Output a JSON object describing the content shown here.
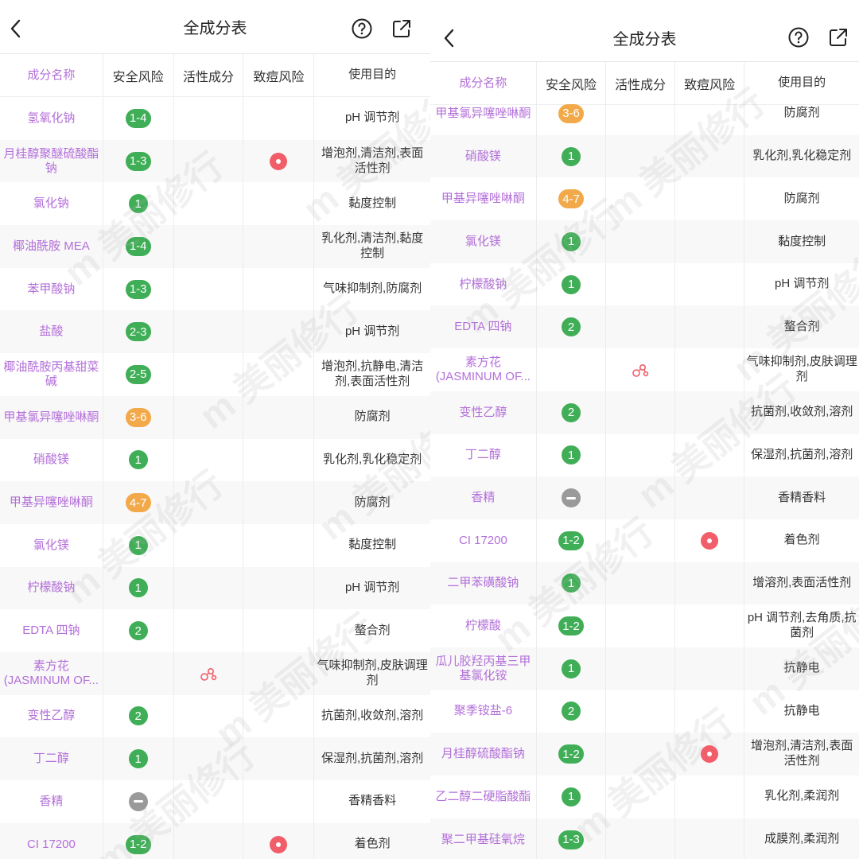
{
  "header": {
    "title": "全成分表"
  },
  "columns": [
    "成分名称",
    "安全风险",
    "活性成分",
    "致痘风险",
    "使用目的"
  ],
  "watermark": "m 美丽修行",
  "colors": {
    "ingredient": "#b36fd9",
    "badge_green": "#3fae56",
    "badge_orange": "#f2a94a",
    "acne": "#f15e6a"
  },
  "left_rows": [
    {
      "name": "氢氧化钠",
      "risk": "1-4",
      "risk_color": "green",
      "active": false,
      "acne": false,
      "purpose": "pH 调节剂"
    },
    {
      "name": "月桂醇聚醚硫酸酯钠",
      "risk": "1-3",
      "risk_color": "green",
      "active": false,
      "acne": true,
      "purpose": "增泡剂,清洁剂,表面活性剂"
    },
    {
      "name": "氯化钠",
      "risk": "1",
      "risk_color": "green",
      "active": false,
      "acne": false,
      "purpose": "黏度控制"
    },
    {
      "name": "椰油酰胺 MEA",
      "risk": "1-4",
      "risk_color": "green",
      "active": false,
      "acne": false,
      "purpose": "乳化剂,清洁剂,黏度控制"
    },
    {
      "name": "苯甲酸钠",
      "risk": "1-3",
      "risk_color": "green",
      "active": false,
      "acne": false,
      "purpose": "气味抑制剂,防腐剂"
    },
    {
      "name": "盐酸",
      "risk": "2-3",
      "risk_color": "green",
      "active": false,
      "acne": false,
      "purpose": "pH 调节剂"
    },
    {
      "name": "椰油酰胺丙基甜菜碱",
      "risk": "2-5",
      "risk_color": "green",
      "active": false,
      "acne": false,
      "purpose": "增泡剂,抗静电,清洁剂,表面活性剂"
    },
    {
      "name": "甲基氯异噻唑啉酮",
      "risk": "3-6",
      "risk_color": "orange",
      "active": false,
      "acne": false,
      "purpose": "防腐剂"
    },
    {
      "name": "硝酸镁",
      "risk": "1",
      "risk_color": "green",
      "active": false,
      "acne": false,
      "purpose": "乳化剂,乳化稳定剂"
    },
    {
      "name": "甲基异噻唑啉酮",
      "risk": "4-7",
      "risk_color": "orange",
      "active": false,
      "acne": false,
      "purpose": "防腐剂"
    },
    {
      "name": "氯化镁",
      "risk": "1",
      "risk_color": "green",
      "active": false,
      "acne": false,
      "purpose": "黏度控制"
    },
    {
      "name": "柠檬酸钠",
      "risk": "1",
      "risk_color": "green",
      "active": false,
      "acne": false,
      "purpose": "pH 调节剂"
    },
    {
      "name": "EDTA 四钠",
      "risk": "2",
      "risk_color": "green",
      "active": false,
      "acne": false,
      "purpose": "螯合剂"
    },
    {
      "name": "素方花 (JASMINUM OF...",
      "risk": "",
      "risk_color": "none",
      "active": true,
      "acne": false,
      "purpose": "气味抑制剂,皮肤调理剂"
    },
    {
      "name": "变性乙醇",
      "risk": "2",
      "risk_color": "green",
      "active": false,
      "acne": false,
      "purpose": "抗菌剂,收敛剂,溶剂"
    },
    {
      "name": "丁二醇",
      "risk": "1",
      "risk_color": "green",
      "active": false,
      "acne": false,
      "purpose": "保湿剂,抗菌剂,溶剂"
    },
    {
      "name": "香精",
      "risk": "",
      "risk_color": "grey",
      "active": false,
      "acne": false,
      "purpose": "香精香料"
    },
    {
      "name": "CI 17200",
      "risk": "1-2",
      "risk_color": "green",
      "active": false,
      "acne": true,
      "purpose": "着色剂"
    }
  ],
  "right_rows": [
    {
      "name": "甲基氯异噻唑啉酮",
      "risk": "3-6",
      "risk_color": "orange",
      "active": false,
      "acne": false,
      "purpose": "防腐剂"
    },
    {
      "name": "硝酸镁",
      "risk": "1",
      "risk_color": "green",
      "active": false,
      "acne": false,
      "purpose": "乳化剂,乳化稳定剂"
    },
    {
      "name": "甲基异噻唑啉酮",
      "risk": "4-7",
      "risk_color": "orange",
      "active": false,
      "acne": false,
      "purpose": "防腐剂"
    },
    {
      "name": "氯化镁",
      "risk": "1",
      "risk_color": "green",
      "active": false,
      "acne": false,
      "purpose": "黏度控制"
    },
    {
      "name": "柠檬酸钠",
      "risk": "1",
      "risk_color": "green",
      "active": false,
      "acne": false,
      "purpose": "pH 调节剂"
    },
    {
      "name": "EDTA 四钠",
      "risk": "2",
      "risk_color": "green",
      "active": false,
      "acne": false,
      "purpose": "螯合剂"
    },
    {
      "name": "素方花 (JASMINUM OF...",
      "risk": "",
      "risk_color": "none",
      "active": true,
      "acne": false,
      "purpose": "气味抑制剂,皮肤调理剂"
    },
    {
      "name": "变性乙醇",
      "risk": "2",
      "risk_color": "green",
      "active": false,
      "acne": false,
      "purpose": "抗菌剂,收敛剂,溶剂"
    },
    {
      "name": "丁二醇",
      "risk": "1",
      "risk_color": "green",
      "active": false,
      "acne": false,
      "purpose": "保湿剂,抗菌剂,溶剂"
    },
    {
      "name": "香精",
      "risk": "",
      "risk_color": "grey",
      "active": false,
      "acne": false,
      "purpose": "香精香料"
    },
    {
      "name": "CI 17200",
      "risk": "1-2",
      "risk_color": "green",
      "active": false,
      "acne": true,
      "purpose": "着色剂"
    },
    {
      "name": "二甲苯磺酸钠",
      "risk": "1",
      "risk_color": "green",
      "active": false,
      "acne": false,
      "purpose": "增溶剂,表面活性剂"
    },
    {
      "name": "柠檬酸",
      "risk": "1-2",
      "risk_color": "green",
      "active": false,
      "acne": false,
      "purpose": "pH 调节剂,去角质,抗菌剂"
    },
    {
      "name": "瓜儿胶羟丙基三甲基氯化铵",
      "risk": "1",
      "risk_color": "green",
      "active": false,
      "acne": false,
      "purpose": "抗静电"
    },
    {
      "name": "聚季铵盐-6",
      "risk": "2",
      "risk_color": "green",
      "active": false,
      "acne": false,
      "purpose": "抗静电"
    },
    {
      "name": "月桂醇硫酸酯钠",
      "risk": "1-2",
      "risk_color": "green",
      "active": false,
      "acne": true,
      "purpose": "增泡剂,清洁剂,表面活性剂"
    },
    {
      "name": "乙二醇二硬脂酸酯",
      "risk": "1",
      "risk_color": "green",
      "active": false,
      "acne": false,
      "purpose": "乳化剂,柔润剂"
    },
    {
      "name": "聚二甲基硅氧烷",
      "risk": "1-3",
      "risk_color": "green",
      "active": false,
      "acne": false,
      "purpose": "成膜剂,柔润剂"
    }
  ]
}
